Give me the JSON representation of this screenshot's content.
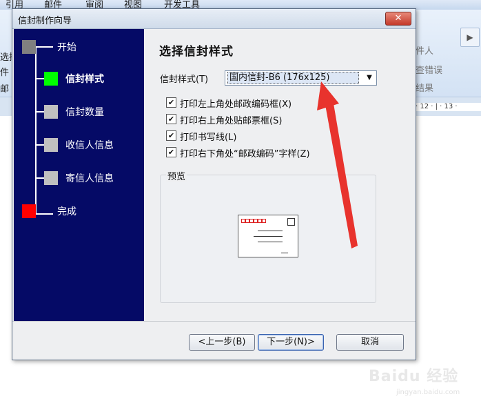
{
  "background": {
    "tabs": [
      "引用",
      "邮件",
      "审阅",
      "视图",
      "开发工具"
    ],
    "left_fragments": [
      "选择",
      "件",
      "邮"
    ],
    "right_items": [
      "件人",
      "查错误",
      "结果"
    ],
    "ruler_text": "· 12 · | · 13 ·"
  },
  "dialog": {
    "title": "信封制作向导",
    "close": "✕",
    "steps": [
      {
        "label": "开始",
        "color": "#808080"
      },
      {
        "label": "信封样式",
        "color": "#00ff00"
      },
      {
        "label": "信封数量",
        "color": "#c0c0c0"
      },
      {
        "label": "收信人信息",
        "color": "#c0c0c0"
      },
      {
        "label": "寄信人信息",
        "color": "#c0c0c0"
      },
      {
        "label": "完成",
        "color": "#ff0000"
      }
    ],
    "heading": "选择信封样式",
    "style_label": "信封样式(T)",
    "style_value": "国内信封-B6 (176x125)",
    "checkboxes": [
      {
        "label": "打印左上角处邮政编码框(X)",
        "checked": true
      },
      {
        "label": "打印右上角处贴邮票框(S)",
        "checked": true
      },
      {
        "label": "打印书写线(L)",
        "checked": true
      },
      {
        "label": "打印右下角处“邮政编码”字样(Z)",
        "checked": true
      }
    ],
    "preview_label": "预览",
    "buttons": {
      "prev": "<上一步(B)",
      "next": "下一步(N)>",
      "cancel": "取消"
    }
  },
  "watermark": {
    "brand": "Baidu 经验",
    "url": "jingyan.baidu.com"
  },
  "colors": {
    "panel": "#050a66",
    "annotation_arrow": "#e8332d"
  }
}
